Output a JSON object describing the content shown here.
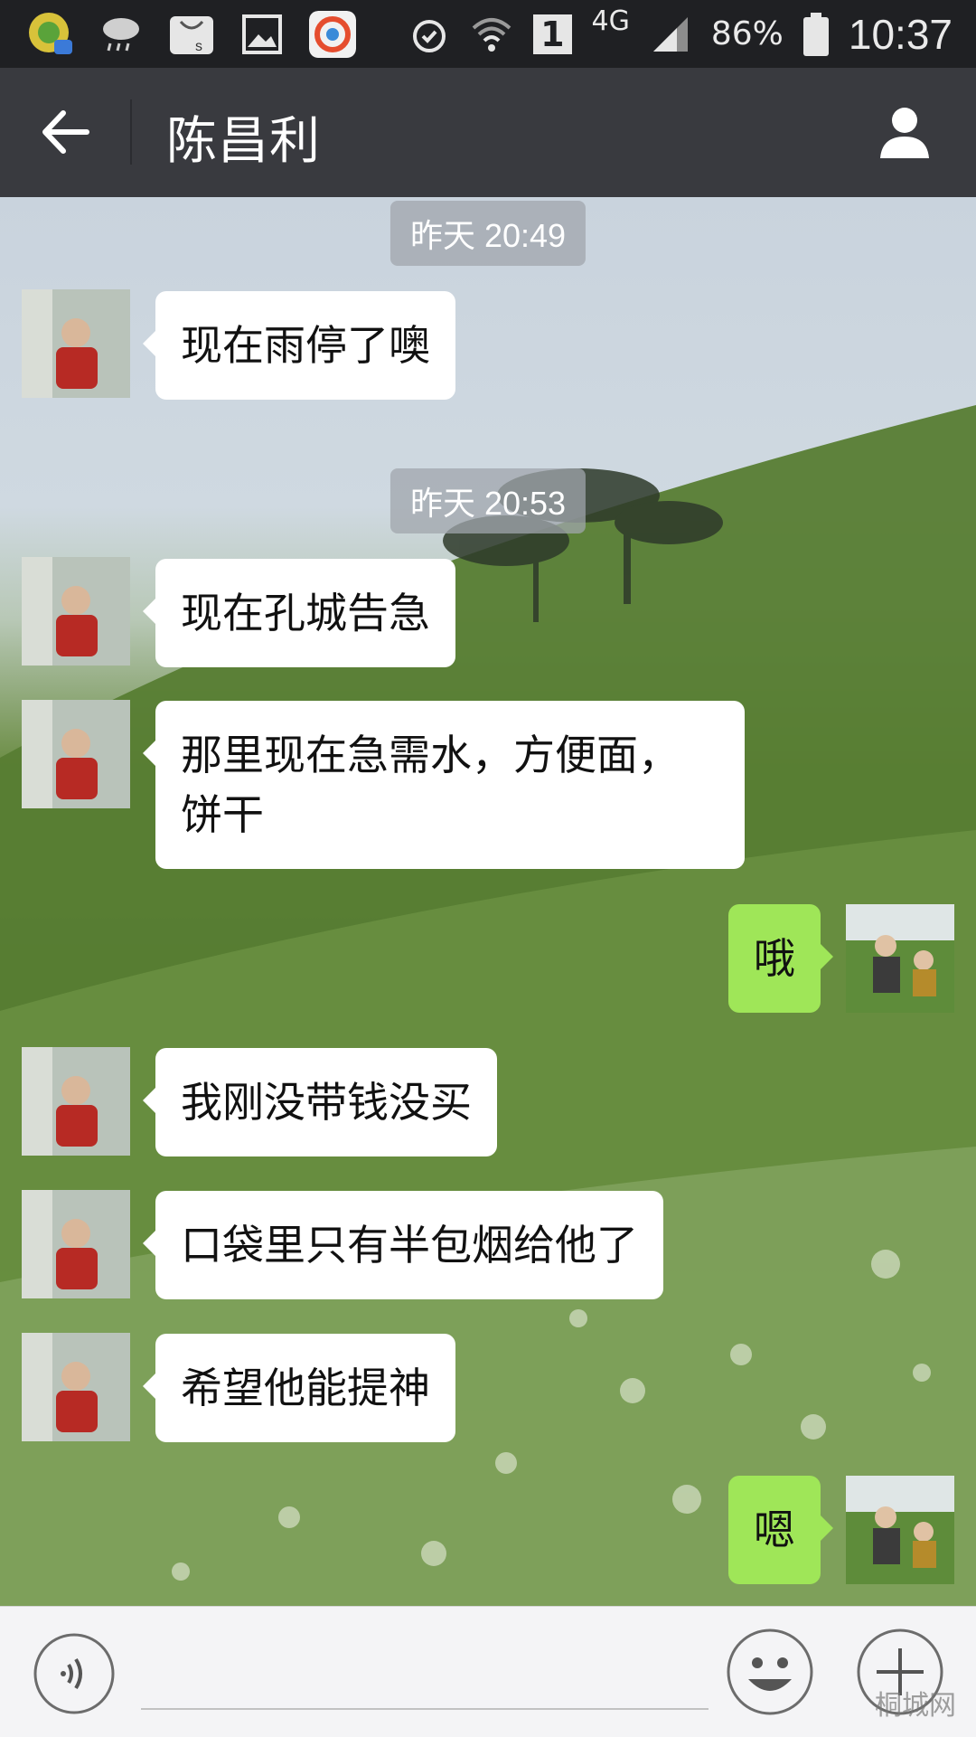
{
  "status_bar": {
    "icons_left": [
      "app-notification-icon",
      "rain-weather-icon",
      "shopping-bag-icon",
      "gallery-icon",
      "browser-app-icon"
    ],
    "sim_slot": "1",
    "network": "4G",
    "battery": "86%",
    "time": "10:37"
  },
  "header": {
    "contact_name": "陈昌利"
  },
  "chat": {
    "timestamps": [
      "昨天 20:49",
      "昨天 20:53"
    ],
    "messages": [
      {
        "from": "contact",
        "text": "现在雨停了噢"
      },
      {
        "from": "contact",
        "text": "现在孔城告急"
      },
      {
        "from": "contact",
        "text": "那里现在急需水，方便面，饼干"
      },
      {
        "from": "me",
        "text": "哦"
      },
      {
        "from": "contact",
        "text": "我刚没带钱没买"
      },
      {
        "from": "contact",
        "text": "口袋里只有半包烟给他了"
      },
      {
        "from": "contact",
        "text": "希望他能提神"
      },
      {
        "from": "me",
        "text": "嗯"
      }
    ]
  },
  "input_bar": {
    "value": "",
    "watermark": "桐城网"
  },
  "colors": {
    "title_bar": "#393a3f",
    "status_bar": "#1f2023",
    "outgoing_bubble": "#9fe658",
    "incoming_bubble": "#ffffff"
  }
}
